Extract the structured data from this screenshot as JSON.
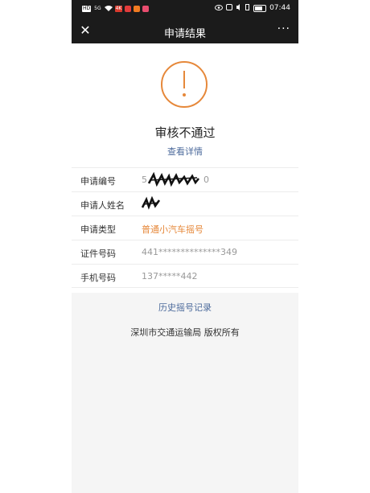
{
  "status_bar": {
    "chips": [
      "HD",
      "5G",
      "4K"
    ],
    "time": "07:44"
  },
  "nav": {
    "title": "申请结果",
    "more": "···"
  },
  "result": {
    "title": "审核不通过",
    "detail_link": "查看详情",
    "accent_color": "#e6883a"
  },
  "info_rows": [
    {
      "label": "申请编号",
      "value": "5",
      "value_suffix": "0"
    },
    {
      "label": "申请人姓名",
      "value": ""
    },
    {
      "label": "申请类型",
      "value": "普通小汽车摇号"
    },
    {
      "label": "证件号码",
      "value": "441**************349"
    },
    {
      "label": "手机号码",
      "value": "137*****442"
    }
  ],
  "history_link": "历史摇号记录",
  "copyright": "深圳市交通运输局 版权所有"
}
